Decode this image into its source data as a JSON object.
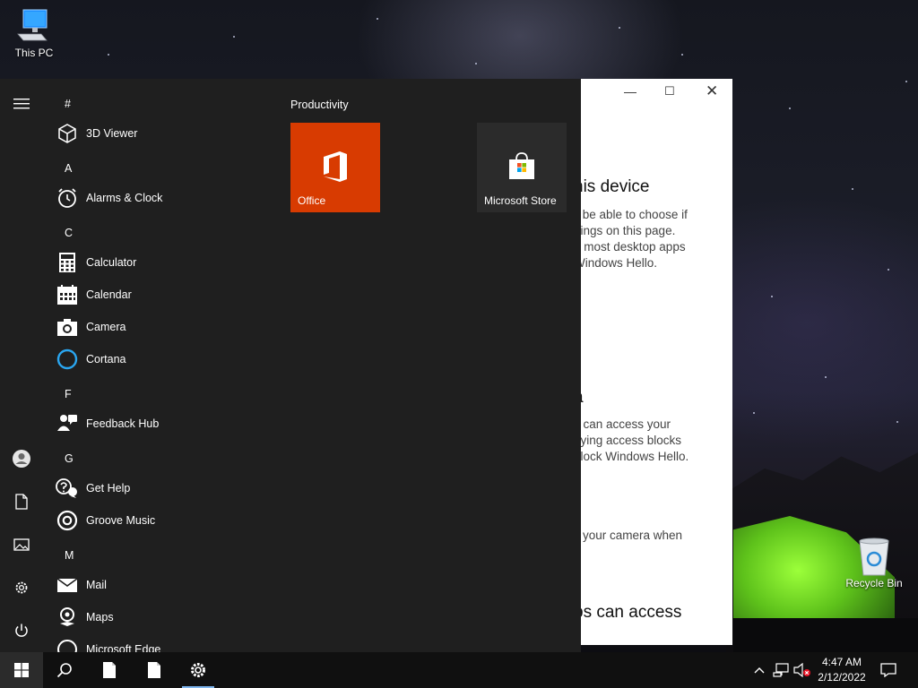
{
  "desktop": {
    "this_pc_label": "This PC",
    "recycle_bin_label": "Recycle Bin"
  },
  "settings_window": {
    "heading_1": "his device",
    "para_1": [
      "ll be able to choose if",
      "ttings on this page.",
      "d most desktop apps",
      "Windows Hello."
    ],
    "heading_2": "a",
    "para_2": [
      "s can access your",
      "aying access blocks",
      "block Windows Hello."
    ],
    "para_3": "your camera when",
    "heading_3": "ps can access"
  },
  "start_menu": {
    "groups": [
      {
        "letter": "#",
        "apps": [
          {
            "label": "3D Viewer",
            "icon": "cube-icon"
          }
        ]
      },
      {
        "letter": "A",
        "apps": [
          {
            "label": "Alarms & Clock",
            "icon": "alarm-clock-icon"
          }
        ]
      },
      {
        "letter": "C",
        "apps": [
          {
            "label": "Calculator",
            "icon": "calculator-icon"
          },
          {
            "label": "Calendar",
            "icon": "calendar-icon"
          },
          {
            "label": "Camera",
            "icon": "camera-icon"
          },
          {
            "label": "Cortana",
            "icon": "cortana-icon"
          }
        ]
      },
      {
        "letter": "F",
        "apps": [
          {
            "label": "Feedback Hub",
            "icon": "feedback-icon"
          }
        ]
      },
      {
        "letter": "G",
        "apps": [
          {
            "label": "Get Help",
            "icon": "help-icon"
          },
          {
            "label": "Groove Music",
            "icon": "music-icon"
          }
        ]
      },
      {
        "letter": "M",
        "apps": [
          {
            "label": "Mail",
            "icon": "mail-icon"
          },
          {
            "label": "Maps",
            "icon": "maps-icon"
          },
          {
            "label": "Microsoft Edge",
            "icon": "edge-icon"
          }
        ]
      }
    ],
    "tiles_group_title": "Productivity",
    "tiles": [
      {
        "label": "Office",
        "color": "#d83b01"
      },
      {
        "label": "Microsoft Store",
        "color": "#2b2b2b"
      }
    ]
  },
  "taskbar": {
    "time": "4:47 AM",
    "date": "2/12/2022"
  },
  "colors": {
    "start_bg": "#1f1f1f",
    "taskbar_bg": "#101010",
    "accent": "#7fb6ef"
  }
}
